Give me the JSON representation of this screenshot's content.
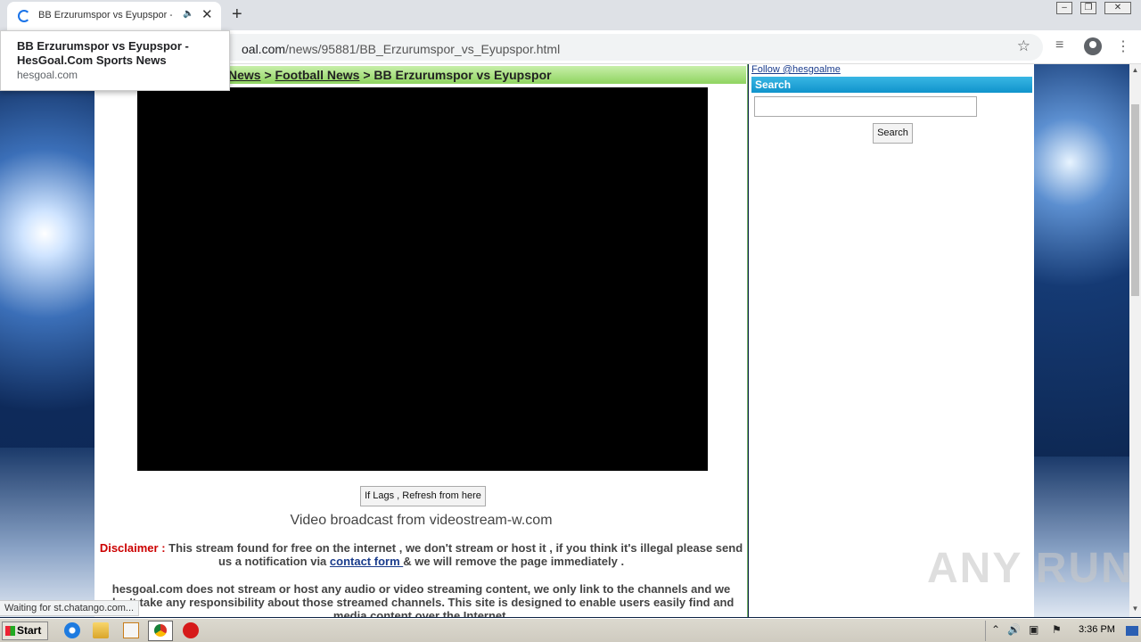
{
  "browser": {
    "tab_title": "BB Erzurumspor vs Eyupspor - H",
    "url_host_tail": "oal.com",
    "url_path": "/news/95881/BB_Erzurumspor_vs_Eyupspor.html"
  },
  "tooltip": {
    "title": "BB Erzurumspor vs Eyupspor - HesGoal.Com Sports News",
    "domain": "hesgoal.com"
  },
  "breadcrumb": {
    "item1": "News",
    "sep1": " > ",
    "item2": "Football News",
    "sep2": " > ",
    "current": "BB Erzurumspor vs Eyupspor"
  },
  "player": {
    "refresh_button": "If Lags , Refresh from here",
    "broadcast_text": "Video broadcast from videostream-w.com"
  },
  "disclaimer": {
    "label": "Disclaimer :",
    "text_before": " This stream found for free on the internet , we don't stream or host it , if you think it's illegal please send us a notification via ",
    "link": "contact form ",
    "text_after": "& we will remove the page immediately ."
  },
  "about": "hesgoal.com  does not stream or host any audio or video streaming content, we only link to the channels and we don't take any responsibility about those streamed channels. This site is designed to enable users easily find and media content over the Internet.",
  "sidebar": {
    "follow_link": "Follow @hesgoalme",
    "search_header": "Search",
    "search_button": "Search"
  },
  "status_bar": "Waiting for st.chatango.com...",
  "watermark": "ANY RUN",
  "taskbar": {
    "start_label": "Start",
    "clock": "3:36 PM"
  }
}
